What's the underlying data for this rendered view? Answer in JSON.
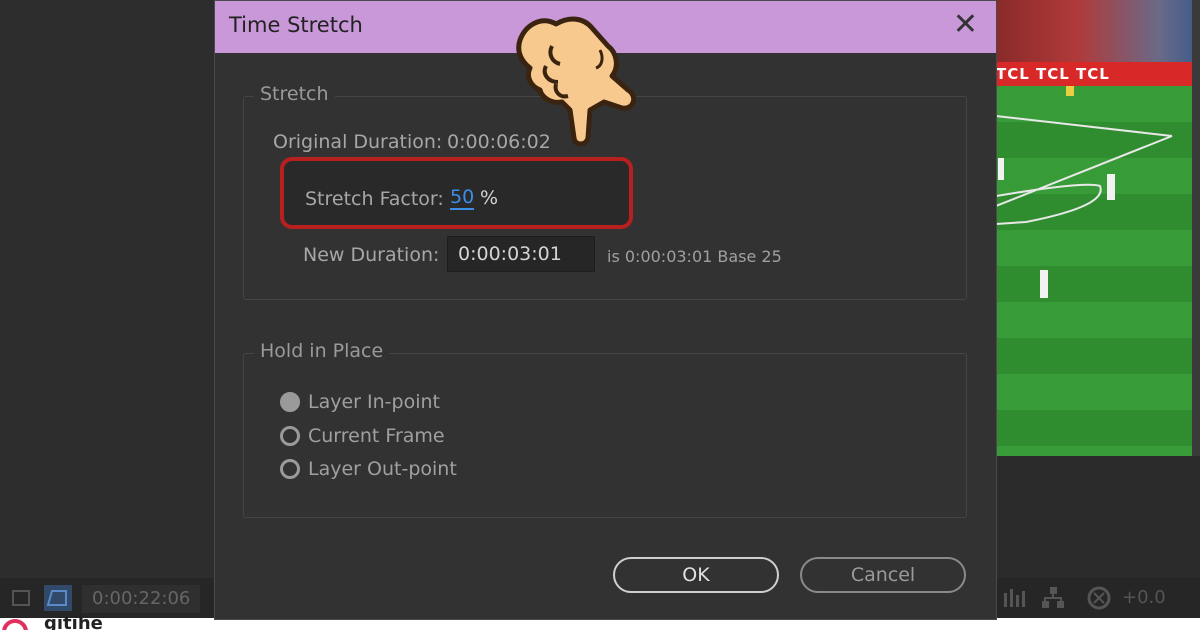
{
  "background": {
    "timecode": "0:00:22:06",
    "zoom_value": "+0.0",
    "video_board_text": "TCL TCL TCL",
    "watermark_text": "gitihe"
  },
  "dialog": {
    "title": "Time Stretch",
    "stretch_group": {
      "legend": "Stretch",
      "original_duration_label": "Original Duration:",
      "original_duration_value": "0:00:06:02",
      "stretch_factor_label": "Stretch Factor:",
      "stretch_factor_value": "50",
      "stretch_factor_unit": "%",
      "new_duration_label": "New Duration:",
      "new_duration_value": "0:00:03:01",
      "new_duration_info": "is 0:00:03:01  Base 25"
    },
    "hold_group": {
      "legend": "Hold in Place",
      "options": [
        {
          "label": "Layer In-point",
          "selected": true
        },
        {
          "label": "Current Frame",
          "selected": false
        },
        {
          "label": "Layer Out-point",
          "selected": false
        }
      ]
    },
    "buttons": {
      "ok": "OK",
      "cancel": "Cancel"
    }
  },
  "colors": {
    "titlebar": "#c898d8",
    "highlight_border": "#b82020",
    "link_blue": "#3a8ee8"
  },
  "icons": [
    "close-icon",
    "pointing-hand-icon",
    "radio-icon"
  ]
}
